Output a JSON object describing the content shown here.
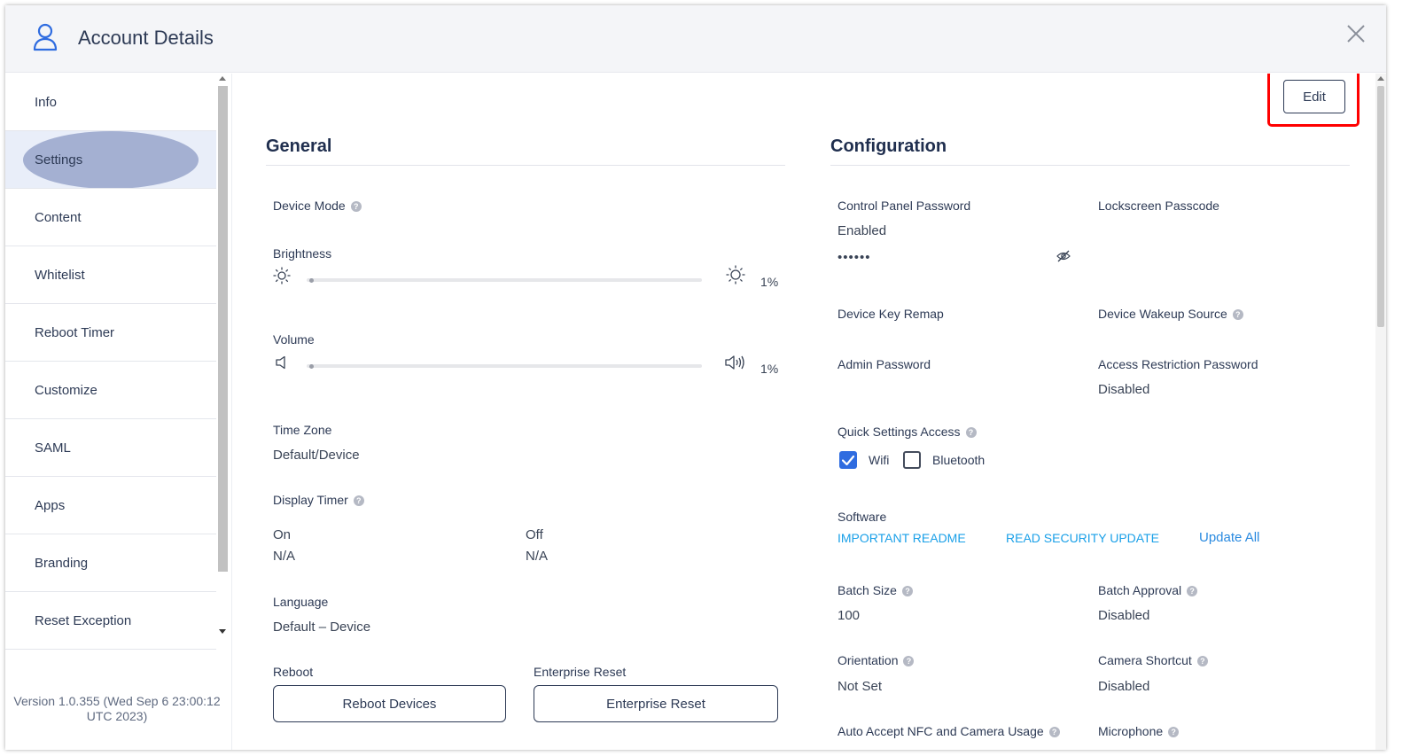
{
  "header": {
    "title": "Account Details",
    "icon": "user-icon",
    "close_icon": "close-icon"
  },
  "sidebar": {
    "items": [
      {
        "label": "Info",
        "active": false
      },
      {
        "label": "Settings",
        "active": true
      },
      {
        "label": "Content",
        "active": false
      },
      {
        "label": "Whitelist",
        "active": false
      },
      {
        "label": "Reboot Timer",
        "active": false
      },
      {
        "label": "Customize",
        "active": false
      },
      {
        "label": "SAML",
        "active": false
      },
      {
        "label": "Apps",
        "active": false
      },
      {
        "label": "Branding",
        "active": false
      },
      {
        "label": "Reset Exception",
        "active": false
      }
    ],
    "version": "Version 1.0.355 (Wed Sep 6 23:00:12 UTC 2023)"
  },
  "toolbar": {
    "edit_label": "Edit"
  },
  "general": {
    "title": "General",
    "device_mode_label": "Device Mode",
    "brightness_label": "Brightness",
    "brightness_value": "1%",
    "brightness_level": 0.01,
    "volume_label": "Volume",
    "volume_value": "1%",
    "volume_level": 0.01,
    "time_zone_label": "Time Zone",
    "time_zone_value": "Default/Device",
    "display_timer_label": "Display Timer",
    "display_on_label": "On",
    "display_on_value": "N/A",
    "display_off_label": "Off",
    "display_off_value": "N/A",
    "language_label": "Language",
    "language_value": "Default – Device",
    "reboot_label": "Reboot",
    "reboot_button": "Reboot Devices",
    "enterprise_reset_label": "Enterprise Reset",
    "enterprise_reset_button": "Enterprise Reset"
  },
  "configuration": {
    "title": "Configuration",
    "control_panel_password_label": "Control Panel Password",
    "control_panel_password_status": "Enabled",
    "control_panel_password_masked": "••••••",
    "lockscreen_passcode_label": "Lockscreen Passcode",
    "device_key_remap_label": "Device Key Remap",
    "device_wakeup_source_label": "Device Wakeup Source",
    "admin_password_label": "Admin Password",
    "access_restriction_password_label": "Access Restriction Password",
    "access_restriction_password_value": "Disabled",
    "quick_settings_label": "Quick Settings Access",
    "wifi_label": "Wifi",
    "wifi_checked": true,
    "bluetooth_label": "Bluetooth",
    "bluetooth_checked": false,
    "software_label": "Software",
    "important_readme_link": "IMPORTANT README",
    "security_update_link": "READ SECURITY UPDATE",
    "update_all_link": "Update All",
    "batch_size_label": "Batch Size",
    "batch_size_value": "100",
    "batch_approval_label": "Batch Approval",
    "batch_approval_value": "Disabled",
    "orientation_label": "Orientation",
    "orientation_value": "Not Set",
    "camera_shortcut_label": "Camera Shortcut",
    "camera_shortcut_value": "Disabled",
    "auto_accept_label": "Auto Accept NFC and Camera Usage",
    "microphone_label": "Microphone"
  },
  "colors": {
    "accent": "#2f6ce0",
    "link": "#1aa0e8",
    "highlight": "#ff0000",
    "active_nav": "#a4b0d2"
  }
}
